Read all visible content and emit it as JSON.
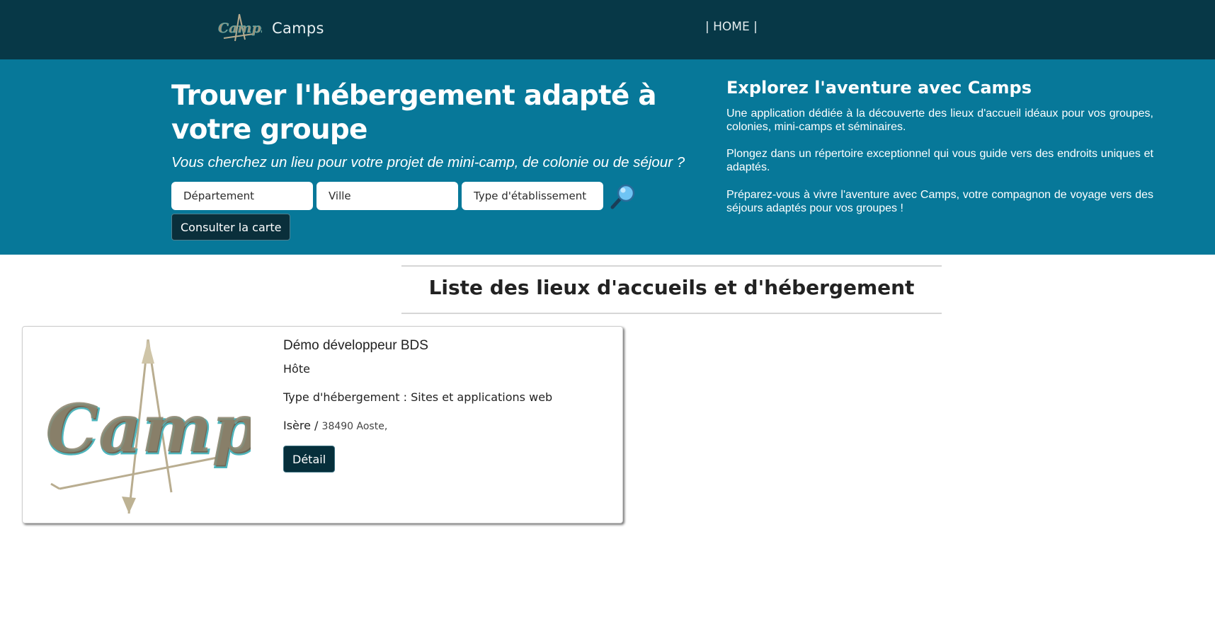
{
  "nav": {
    "brand_name": "Camps",
    "home_link": "| HOME |"
  },
  "hero": {
    "title": "Trouver l'hébergement adapté à votre groupe",
    "subtitle": "Vous cherchez un lieu pour votre projet de mini-camp, de colonie ou de séjour ?",
    "search": {
      "departement_placeholder": "Département",
      "ville_placeholder": "Ville",
      "type_placeholder": "Type d'établissement"
    },
    "map_button": "Consulter la carte",
    "side_title": "Explorez l'aventure avec Camps",
    "paragraphs": [
      "Une application dédiée à la découverte des lieux d'accueil idéaux pour vos groupes, colonies, mini-camps et séminaires.",
      "Plongez dans un répertoire exceptionnel qui vous guide vers des endroits uniques et adaptés.",
      "Préparez-vous à vivre l'aventure avec Camps, votre compagnon de voyage vers des séjours adaptés pour vos groupes !"
    ]
  },
  "list": {
    "title": "Liste des lieux d'accueils et d'hébergement",
    "items": [
      {
        "name": "Démo développeur BDS",
        "role": "Hôte",
        "type_line": "Type d'hébergement : Sites et applications web",
        "region": "Isère /",
        "city": "38490 Aoste,",
        "detail_button": "Détail"
      }
    ]
  },
  "colors": {
    "navbar_bg": "#073847",
    "hero_bg": "#077899",
    "button_bg": "#062f3b"
  },
  "icons": {
    "search": "magnifier-icon",
    "logo": "camps-logo"
  }
}
